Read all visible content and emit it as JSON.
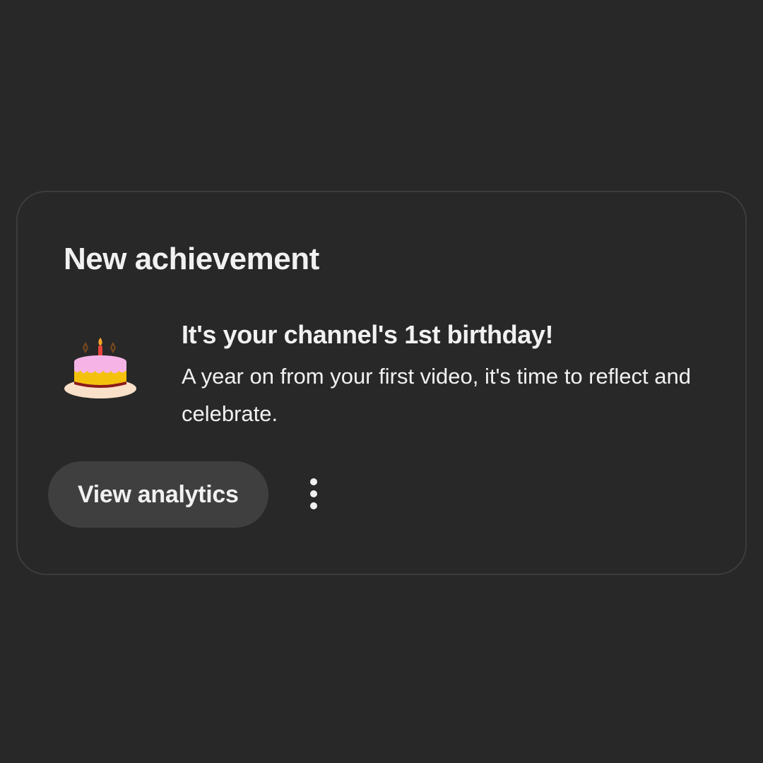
{
  "card": {
    "title": "New achievement",
    "icon": "birthday-cake-icon",
    "heading": "It's your channel's 1st birthday!",
    "body": "A year on from your first video, it's time to reflect and celebrate.",
    "primary_action_label": "View analytics",
    "more_icon": "more-vertical-icon"
  },
  "colors": {
    "background": "#282828",
    "card_border": "#3c3c3c",
    "button_background": "#3f3f3f",
    "text": "#f1f1f1"
  }
}
